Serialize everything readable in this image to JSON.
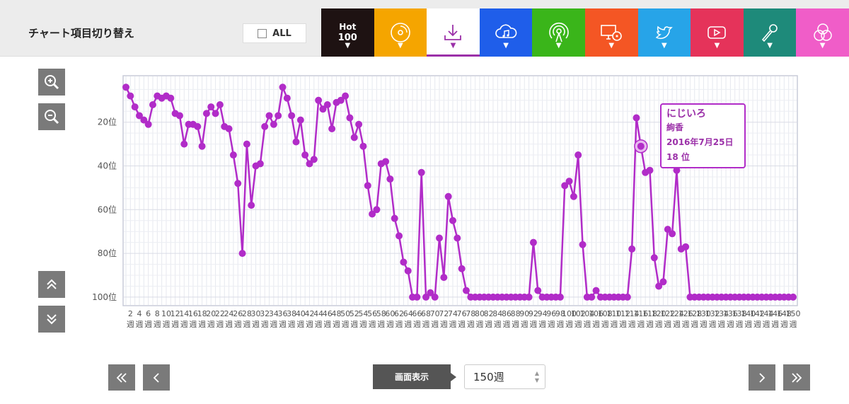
{
  "header": {
    "title": "チャート項目切り替え",
    "all_label": "ALL"
  },
  "tabs": [
    {
      "name": "hot100",
      "line1": "Hot",
      "line2": "100",
      "color": "#1e1212"
    },
    {
      "name": "sales",
      "icon": "cd-icon",
      "color": "#f5a500"
    },
    {
      "name": "download",
      "icon": "download-icon",
      "color": "#ffffff",
      "active": true
    },
    {
      "name": "streaming",
      "icon": "cloud-music-icon",
      "color": "#1f5eea"
    },
    {
      "name": "radio",
      "icon": "radio-broadcast-icon",
      "color": "#3ab51a"
    },
    {
      "name": "lookup",
      "icon": "pc-cd-icon",
      "color": "#f45624"
    },
    {
      "name": "twitter",
      "icon": "twitter-icon",
      "color": "#27a4e8"
    },
    {
      "name": "video",
      "icon": "play-button-icon",
      "color": "#e5335a"
    },
    {
      "name": "karaoke",
      "icon": "microphone-icon",
      "color": "#1e8a7a"
    },
    {
      "name": "all",
      "icon": "venn-icon",
      "color": "#f05dc8"
    }
  ],
  "tooltip": {
    "title": "にじいろ",
    "artist": "絢香",
    "date": "2016年7月25日",
    "rank": "18 位"
  },
  "controls": {
    "screen_label": "画面表示",
    "weeks_value": "150週"
  },
  "chart_data": {
    "type": "line",
    "title": "",
    "xlabel": "",
    "ylabel": "",
    "y_reversed": true,
    "ylim": [
      101,
      1
    ],
    "y_ticks": [
      20,
      40,
      60,
      80,
      100
    ],
    "y_tick_suffix": "位",
    "x_tick_suffix": "週",
    "x": [
      1,
      2,
      3,
      4,
      5,
      6,
      7,
      8,
      9,
      10,
      11,
      12,
      13,
      14,
      15,
      16,
      17,
      18,
      19,
      20,
      21,
      22,
      23,
      24,
      25,
      26,
      27,
      28,
      29,
      30,
      31,
      32,
      33,
      34,
      35,
      36,
      37,
      38,
      39,
      40,
      41,
      42,
      43,
      44,
      45,
      46,
      47,
      48,
      49,
      50,
      51,
      52,
      53,
      54,
      55,
      56,
      57,
      58,
      59,
      60,
      61,
      62,
      63,
      64,
      65,
      66,
      67,
      68,
      69,
      70,
      71,
      72,
      73,
      74,
      75,
      76,
      77,
      78,
      79,
      80,
      81,
      82,
      83,
      84,
      85,
      86,
      87,
      88,
      89,
      90,
      91,
      92,
      93,
      94,
      95,
      96,
      97,
      98,
      99,
      100,
      101,
      102,
      103,
      104,
      105,
      106,
      107,
      108,
      109,
      110,
      111,
      112,
      113,
      114,
      115,
      116,
      117,
      118,
      119,
      120,
      121,
      122,
      123,
      124,
      125,
      126,
      127,
      128,
      129,
      130,
      131,
      132,
      133,
      134,
      135,
      136,
      137,
      138,
      139,
      140,
      141,
      142,
      143,
      144,
      145,
      146,
      147,
      148,
      149,
      150
    ],
    "series": [
      {
        "color": "#b12cc8",
        "values": [
          4,
          8,
          13,
          17,
          19,
          21,
          12,
          8,
          9,
          8,
          9,
          16,
          17,
          30,
          21,
          21,
          22,
          31,
          16,
          13,
          16,
          12,
          22,
          23,
          35,
          48,
          80,
          30,
          58,
          40,
          39,
          22,
          17,
          21,
          17,
          4,
          9,
          17,
          29,
          19,
          35,
          39,
          37,
          10,
          14,
          12,
          23,
          11,
          10,
          8,
          18,
          27,
          21,
          31,
          49,
          62,
          60,
          39,
          38,
          46,
          64,
          72,
          84,
          88,
          100,
          100,
          43,
          100,
          98,
          100,
          73,
          91,
          54,
          65,
          73,
          87,
          97,
          100,
          100,
          100,
          100,
          100,
          100,
          100,
          100,
          100,
          100,
          100,
          100,
          100,
          100,
          75,
          97,
          100,
          100,
          100,
          100,
          100,
          49,
          47,
          54,
          35,
          76,
          100,
          100,
          97,
          100,
          100,
          100,
          100,
          100,
          100,
          100,
          78,
          18,
          31,
          43,
          42,
          82,
          95,
          93,
          69,
          71,
          42,
          78,
          77,
          100,
          100,
          100,
          100,
          100,
          100,
          100,
          100,
          100,
          100,
          100,
          100,
          100,
          100,
          100,
          100,
          100,
          100,
          100,
          100,
          100,
          100,
          100,
          100
        ],
        "highlight_index": 115
      }
    ]
  }
}
